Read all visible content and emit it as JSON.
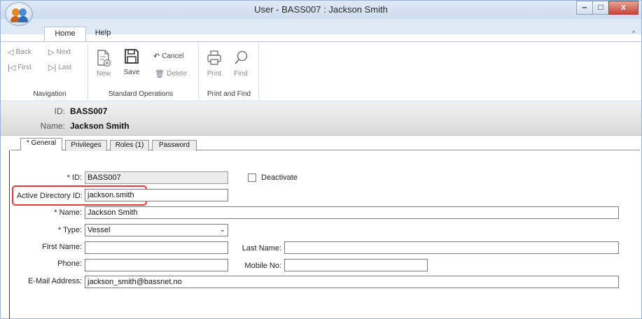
{
  "window": {
    "title": "User - BASS007 : Jackson Smith",
    "minimize": "‒",
    "maximize": "□",
    "close": "x"
  },
  "ribbon": {
    "tabs": [
      {
        "label": "Home",
        "active": true
      },
      {
        "label": "Help",
        "active": false
      }
    ],
    "collapse_glyph": "^",
    "navigation": {
      "back": "Back",
      "next": "Next",
      "first": "First",
      "last": "Last",
      "group_label": "Navigation"
    },
    "standard_operations": {
      "new": "New",
      "save": "Save",
      "cancel": "Cancel",
      "delete": "Delete",
      "group_label": "Standard Operations"
    },
    "print_find": {
      "print": "Print",
      "find": "Find",
      "group_label": "Print and Find"
    }
  },
  "header": {
    "id_label": "ID:",
    "id_value": "BASS007",
    "name_label": "Name:",
    "name_value": "Jackson Smith"
  },
  "tabs": [
    {
      "label": "* General",
      "active": true
    },
    {
      "label": "Privileges",
      "active": false
    },
    {
      "label": "Roles (1)",
      "active": false
    },
    {
      "label": "Password",
      "active": false
    }
  ],
  "form": {
    "id": {
      "label": "* ID:",
      "value": "BASS007"
    },
    "deactivate": {
      "label": "Deactivate",
      "checked": false
    },
    "active_directory_id": {
      "label": "Active Directory ID:",
      "value": "jackson.smith"
    },
    "name": {
      "label": "* Name:",
      "value": "Jackson Smith"
    },
    "type": {
      "label": "* Type:",
      "value": "Vessel"
    },
    "first_name": {
      "label": "First Name:",
      "value": ""
    },
    "last_name": {
      "label": "Last Name:",
      "value": ""
    },
    "phone": {
      "label": "Phone:",
      "value": ""
    },
    "mobile_no": {
      "label": "Mobile No:",
      "value": ""
    },
    "email": {
      "label": "E-Mail Address:",
      "value": "jackson_smith@bassnet.no"
    }
  },
  "colors": {
    "highlight": "#e53935",
    "title_bar": "#dfe9f6",
    "close_button": "#c7453b"
  }
}
